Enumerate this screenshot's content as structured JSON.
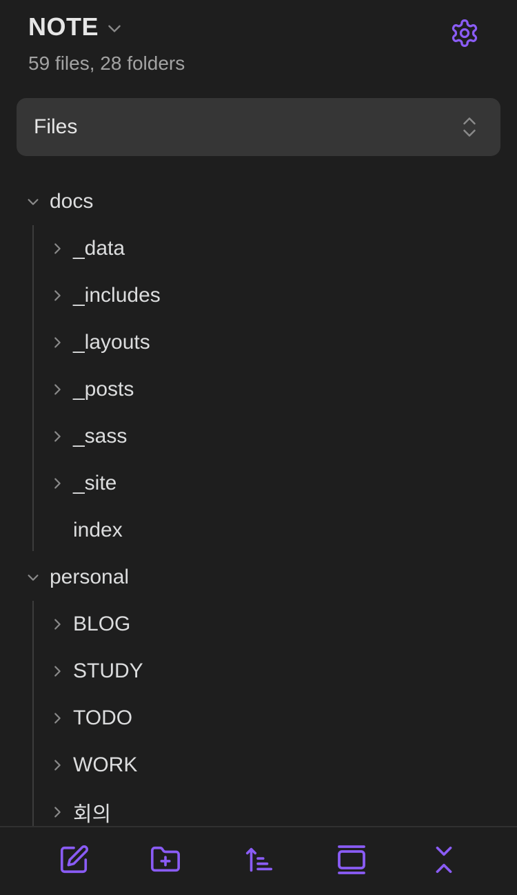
{
  "colors": {
    "background": "#1e1e1e",
    "accent": "#8a5cf5",
    "select_bg": "#363636",
    "text": "#dcddde",
    "muted": "#a3a3a3",
    "chevron": "#8a8a8a"
  },
  "header": {
    "vault_name": "NOTE",
    "stats": "59 files, 28 folders",
    "settings_icon": "gear-icon",
    "vault_menu_icon": "chevron-down-icon"
  },
  "view_select": {
    "selected": "Files",
    "icon": "chevron-up-down-icon"
  },
  "tree": {
    "folders": [
      {
        "name": "docs",
        "expanded": true,
        "children": [
          {
            "name": "_data",
            "type": "folder"
          },
          {
            "name": "_includes",
            "type": "folder"
          },
          {
            "name": "_layouts",
            "type": "folder"
          },
          {
            "name": "_posts",
            "type": "folder"
          },
          {
            "name": "_sass",
            "type": "folder"
          },
          {
            "name": "_site",
            "type": "folder"
          },
          {
            "name": "index",
            "type": "file"
          }
        ]
      },
      {
        "name": "personal",
        "expanded": true,
        "children": [
          {
            "name": "BLOG",
            "type": "folder"
          },
          {
            "name": "STUDY",
            "type": "folder"
          },
          {
            "name": "TODO",
            "type": "folder"
          },
          {
            "name": "WORK",
            "type": "folder"
          },
          {
            "name": "회의",
            "type": "folder"
          }
        ]
      }
    ]
  },
  "bottom_bar": {
    "buttons": [
      {
        "icon": "new-note-icon"
      },
      {
        "icon": "new-folder-icon"
      },
      {
        "icon": "sort-icon"
      },
      {
        "icon": "collapse-view-icon"
      },
      {
        "icon": "collapse-all-icon"
      }
    ]
  }
}
